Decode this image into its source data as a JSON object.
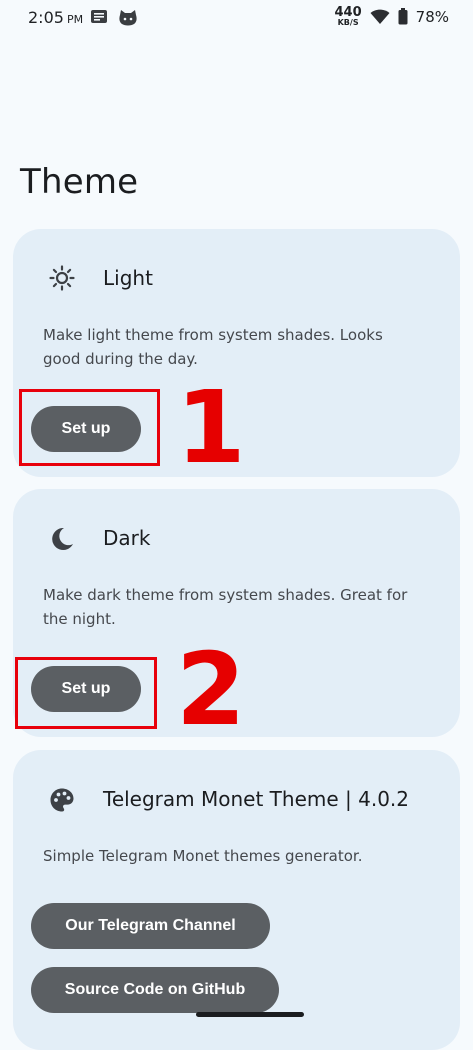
{
  "status_bar": {
    "time": "2:05",
    "ampm": "PM",
    "netspeed_value": "440",
    "netspeed_unit": "KB/S",
    "battery": "78%"
  },
  "page": {
    "title": "Theme"
  },
  "cards": {
    "light": {
      "title": "Light",
      "icon": "sun-icon",
      "description": "Make light theme from system shades. Looks good during the day.",
      "button": "Set up",
      "step": "1"
    },
    "dark": {
      "title": "Dark",
      "icon": "moon-icon",
      "description": "Make dark theme from system shades. Great for the night.",
      "button": "Set up",
      "step": "2"
    },
    "about": {
      "title": "Telegram Monet Theme | 4.0.2",
      "icon": "palette-icon",
      "description": "Simple Telegram Monet themes generator.",
      "channel_button": "Our Telegram Channel",
      "github_button": "Source Code on GitHub"
    }
  },
  "colors": {
    "background": "#f6fafd",
    "card": "#e3eef7",
    "button": "#5b5f63",
    "annotation_red": "#e60000"
  }
}
